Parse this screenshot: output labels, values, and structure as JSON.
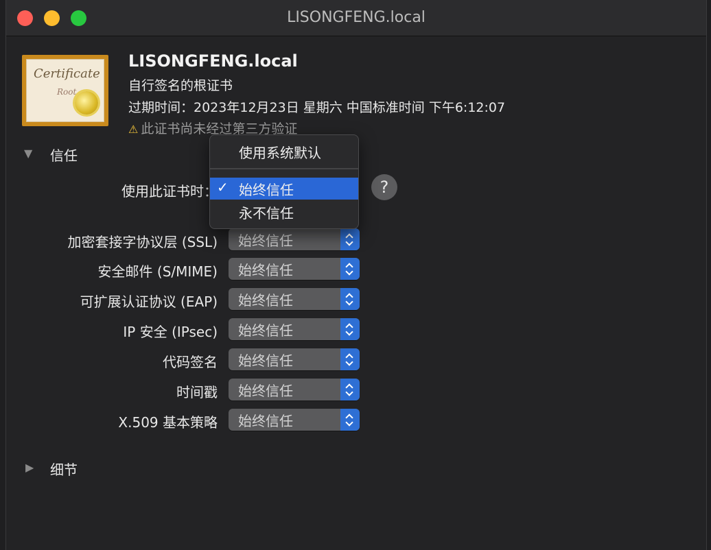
{
  "window": {
    "title": "LISONGFENG.local"
  },
  "certificate": {
    "icon_text": "Certificate",
    "icon_subtext": "Root",
    "name": "LISONGFENG.local",
    "kind": "自行签名的根证书",
    "expiry": "过期时间：2023年12月23日 星期六 中国标准时间 下午6:12:07",
    "warning": "此证书尚未经过第三方验证"
  },
  "trust": {
    "section_label": "信任",
    "when_using_label": "使用此证书时：",
    "rows": [
      {
        "label": "加密套接字协议层 (SSL)",
        "value": "始终信任"
      },
      {
        "label": "安全邮件 (S/MIME)",
        "value": "始终信任"
      },
      {
        "label": "可扩展认证协议 (EAP)",
        "value": "始终信任"
      },
      {
        "label": "IP 安全 (IPsec)",
        "value": "始终信任"
      },
      {
        "label": "代码签名",
        "value": "始终信任"
      },
      {
        "label": "时间戳",
        "value": "始终信任"
      },
      {
        "label": "X.509 基本策略",
        "value": "始终信任"
      }
    ],
    "help": "?"
  },
  "menu": {
    "items": [
      {
        "label": "使用系统默认",
        "selected": false
      },
      {
        "label": "始终信任",
        "selected": true
      },
      {
        "label": "永不信任",
        "selected": false
      }
    ],
    "check": "✓"
  },
  "details": {
    "section_label": "细节"
  },
  "icons": {
    "warning": "⚠",
    "disclosure_open": "▼",
    "disclosure_closed": "▶"
  }
}
